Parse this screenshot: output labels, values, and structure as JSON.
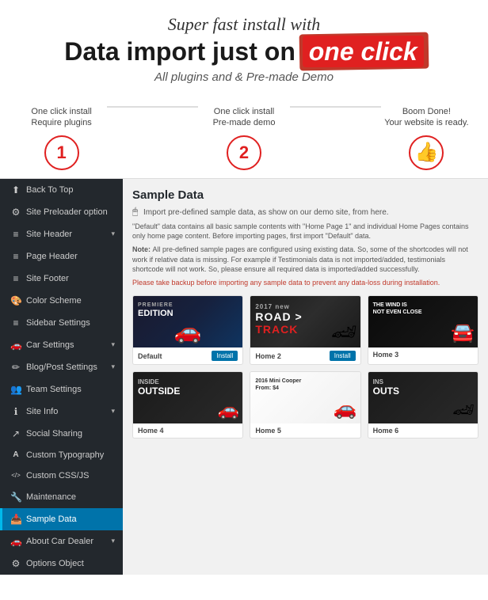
{
  "header": {
    "super_fast": "Super fast install with",
    "main_title_start": "Data import just on ",
    "main_title_highlight": "one click",
    "subtitle": "All plugins and & Pre-made Demo"
  },
  "steps": [
    {
      "label": "One click install\nRequire plugins",
      "number": "1",
      "type": "number"
    },
    {
      "label": "One click install\nPre-made demo",
      "number": "2",
      "type": "number"
    },
    {
      "label": "Boom Done!\nYour website is ready.",
      "icon": "👍",
      "type": "icon"
    }
  ],
  "sidebar": {
    "items": [
      {
        "icon": "⬆",
        "label": "Back To Top",
        "arrow": ""
      },
      {
        "icon": "⚙",
        "label": "Site Preloader option",
        "arrow": ""
      },
      {
        "icon": "≡",
        "label": "Site Header",
        "arrow": "▾"
      },
      {
        "icon": "≡",
        "label": "Page Header",
        "arrow": ""
      },
      {
        "icon": "≡",
        "label": "Site Footer",
        "arrow": ""
      },
      {
        "icon": "🎨",
        "label": "Color Scheme",
        "arrow": ""
      },
      {
        "icon": "≡",
        "label": "Sidebar Settings",
        "arrow": ""
      },
      {
        "icon": "🚗",
        "label": "Car Settings",
        "arrow": "▾"
      },
      {
        "icon": "✏",
        "label": "Blog/Post Settings",
        "arrow": "▾"
      },
      {
        "icon": "👥",
        "label": "Team Settings",
        "arrow": ""
      },
      {
        "icon": "ℹ",
        "label": "Site Info",
        "arrow": "▾"
      },
      {
        "icon": "↗",
        "label": "Social Sharing",
        "arrow": ""
      },
      {
        "icon": "T",
        "label": "Custom Typography",
        "arrow": ""
      },
      {
        "icon": "</>",
        "label": "Custom CSS/JS",
        "arrow": ""
      },
      {
        "icon": "🔧",
        "label": "Maintenance",
        "arrow": ""
      },
      {
        "icon": "📥",
        "label": "Sample Data",
        "arrow": "",
        "active": true
      },
      {
        "icon": "🚗",
        "label": "About Car Dealer",
        "arrow": "▾"
      },
      {
        "icon": "⚙",
        "label": "Options Object",
        "arrow": ""
      }
    ]
  },
  "main": {
    "title": "Sample Data",
    "desc": "Import pre-defined sample data, as show on our demo site, from here.",
    "default_desc": "\"Default\" data contains all basic sample contents with \"Home Page 1\" and individual Home Pages contains only home page content. Before importing pages, first import \"Default\" data.",
    "note_label": "Note: ",
    "note": "All pre-defined sample pages are configured using existing data. So, some of the shortcodes will not work if relative data is missing. For example if Testimonials data is not imported/added, testimonials shortcode will not work. So, please ensure all required data is imported/added successfully.",
    "warning": "Please take backup before importing any sample data to prevent any data-loss during installation.",
    "thumbs": [
      {
        "name": "Default",
        "type": "default",
        "install": "Install"
      },
      {
        "name": "Home 2",
        "type": "home2",
        "install": "Install"
      },
      {
        "name": "Home 3",
        "type": "home3",
        "install": ""
      },
      {
        "name": "Home 4",
        "type": "home4",
        "install": ""
      },
      {
        "name": "Home 5",
        "type": "home5",
        "install": ""
      },
      {
        "name": "Home 6",
        "type": "home6",
        "install": ""
      }
    ]
  }
}
